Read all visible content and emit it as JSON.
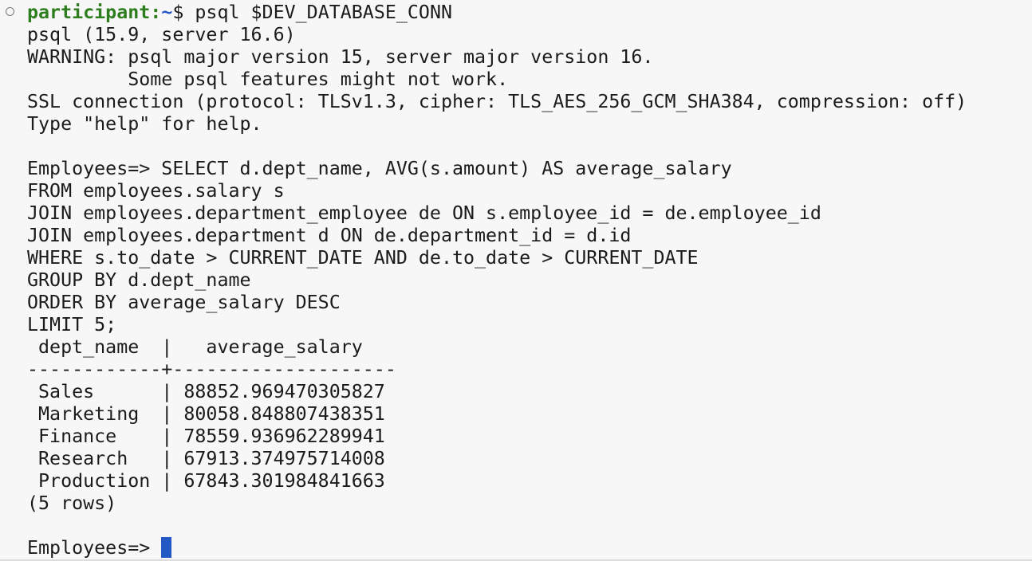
{
  "prompt": {
    "user": "participant:",
    "cwd": "~",
    "symbol": "$ ",
    "command": "psql $DEV_DATABASE_CONN"
  },
  "banner": [
    "psql (15.9, server 16.6)",
    "WARNING: psql major version 15, server major version 16.",
    "         Some psql features might not work.",
    "SSL connection (protocol: TLSv1.3, cipher: TLS_AES_256_GCM_SHA384, compression: off)",
    "Type \"help\" for help."
  ],
  "query": [
    "Employees=> SELECT d.dept_name, AVG(s.amount) AS average_salary",
    "FROM employees.salary s",
    "JOIN employees.department_employee de ON s.employee_id = de.employee_id",
    "JOIN employees.department d ON de.department_id = d.id",
    "WHERE s.to_date > CURRENT_DATE AND de.to_date > CURRENT_DATE",
    "GROUP BY d.dept_name",
    "ORDER BY average_salary DESC",
    "LIMIT 5;"
  ],
  "result": {
    "header": " dept_name  |   average_salary",
    "separator": "------------+--------------------",
    "rows": [
      " Sales      | 88852.969470305827",
      " Marketing  | 80058.848807438351",
      " Finance    | 78559.936962289941",
      " Research   | 67913.374975714008",
      " Production | 67843.301984841663"
    ],
    "footer": "(5 rows)"
  },
  "final_prompt": "Employees=> ",
  "colors": {
    "background": "#f7f7f7",
    "text": "#1b1b1b",
    "user": "#2e7d1e",
    "cwd": "#2456c8",
    "cursor": "#2359c4"
  }
}
